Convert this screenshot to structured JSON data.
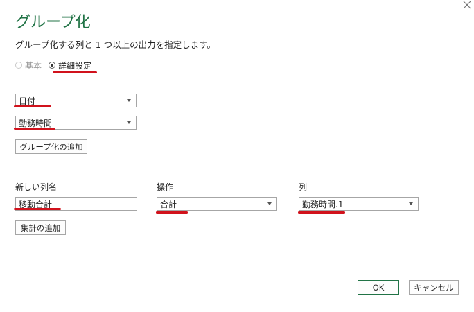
{
  "dialog": {
    "title": "グループ化",
    "description": "グループ化する列と 1 つ以上の出力を指定します。",
    "close_icon": "close-icon"
  },
  "mode": {
    "options": [
      {
        "label": "基本",
        "selected": false
      },
      {
        "label": "詳細設定",
        "selected": true
      }
    ]
  },
  "group_by": {
    "columns": [
      "日付",
      "勤務時間"
    ],
    "add_button": "グループ化の追加"
  },
  "aggregation": {
    "headers": {
      "new_column": "新しい列名",
      "operation": "操作",
      "column": "列"
    },
    "rows": [
      {
        "new_column": "移動合計",
        "operation": "合計",
        "column": "勤務時間.1"
      }
    ],
    "add_button": "集計の追加"
  },
  "footer": {
    "ok": "OK",
    "cancel": "キャンセル"
  },
  "colors": {
    "title": "#217346",
    "annotation_underline": "#d1121c"
  }
}
